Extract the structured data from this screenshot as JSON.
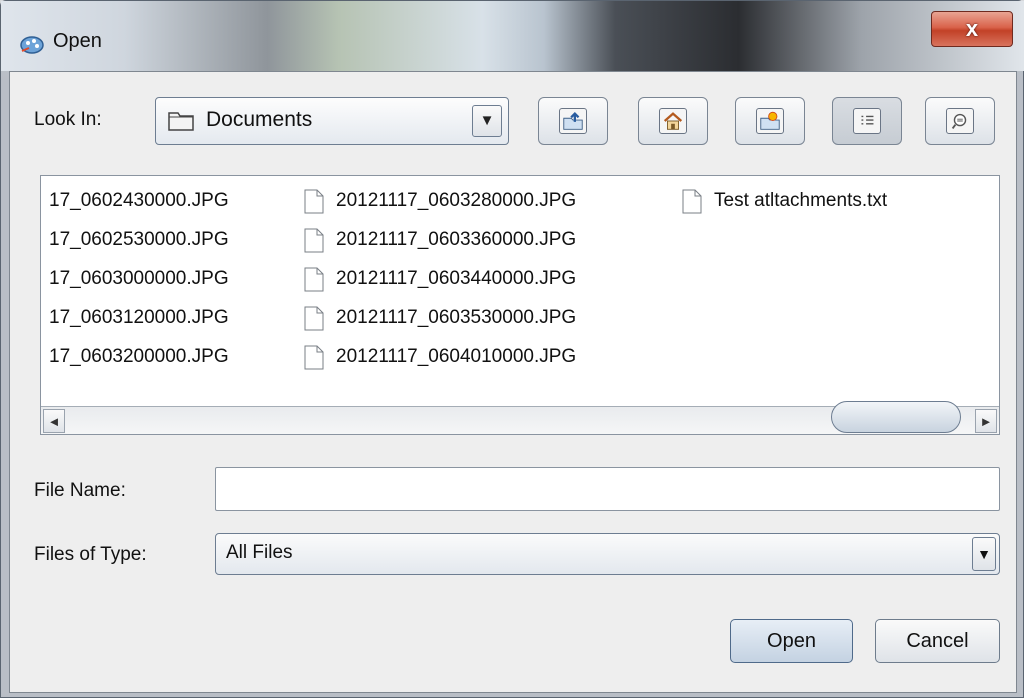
{
  "window": {
    "title": "Open",
    "close_glyph": "x"
  },
  "toolbar": {
    "look_in_label": "Look In:",
    "look_in_value": "Documents",
    "dropdown_glyph": "▼",
    "buttons": [
      {
        "name": "up-one-level-button",
        "icon": "folder-up-icon",
        "pressed": false
      },
      {
        "name": "home-button",
        "icon": "home-icon",
        "pressed": false
      },
      {
        "name": "new-folder-button",
        "icon": "new-folder-icon",
        "pressed": false
      },
      {
        "name": "list-view-button",
        "icon": "list-view-icon",
        "pressed": true
      },
      {
        "name": "details-view-button",
        "icon": "details-view-icon",
        "pressed": false
      }
    ]
  },
  "files": {
    "column1": [
      "17_0602430000.JPG",
      "17_0602530000.JPG",
      "17_0603000000.JPG",
      "17_0603120000.JPG",
      "17_0603200000.JPG"
    ],
    "column2": [
      "20121117_0603280000.JPG",
      "20121117_0603360000.JPG",
      "20121117_0603440000.JPG",
      "20121117_0603530000.JPG",
      "20121117_0604010000.JPG"
    ],
    "column3": [
      "Test atltachments.txt"
    ]
  },
  "scrollbar": {
    "left_glyph": "◄",
    "right_glyph": "►"
  },
  "form": {
    "file_name_label": "File Name:",
    "file_name_value": "",
    "files_of_type_label": "Files of Type:",
    "files_of_type_value": "All Files"
  },
  "buttons": {
    "open": "Open",
    "cancel": "Cancel"
  },
  "colors": {
    "accent": "#c24127",
    "primary_button": "#c4d2e2"
  }
}
